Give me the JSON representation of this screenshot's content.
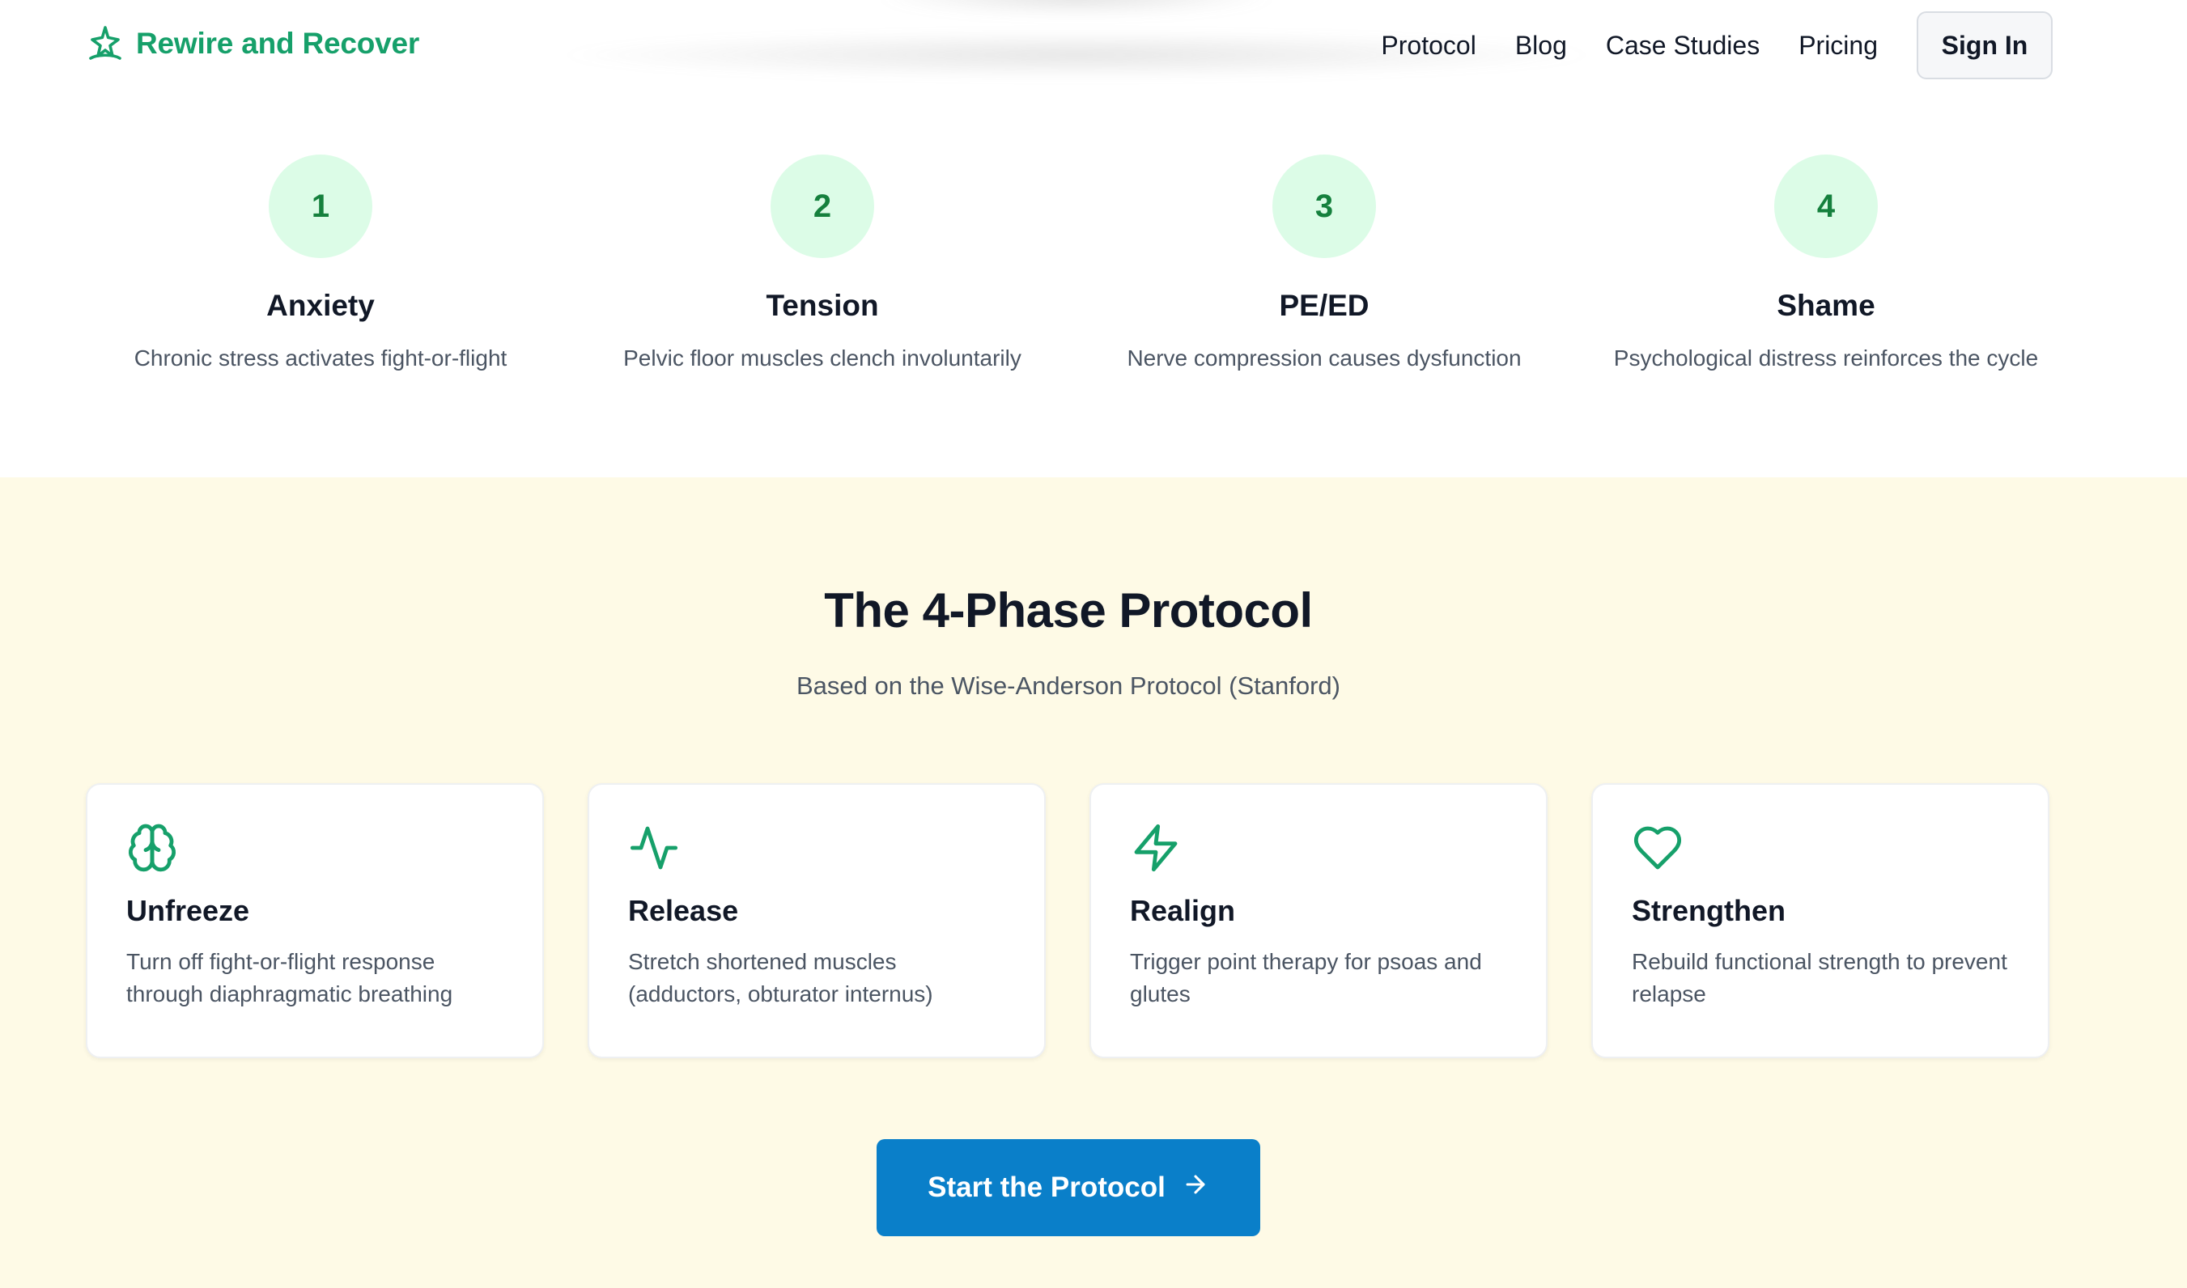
{
  "colors": {
    "brand": "#16a06a",
    "accent_blue": "#0a7fc9",
    "section_bg": "#fefae6",
    "step_circle": "#dcfce7"
  },
  "brand": {
    "name": "Rewire and Recover",
    "icon": "sprout-star-icon"
  },
  "nav": {
    "links": [
      "Protocol",
      "Blog",
      "Case Studies",
      "Pricing"
    ],
    "sign_in": "Sign In"
  },
  "cycle": {
    "steps": [
      {
        "number": "1",
        "title": "Anxiety",
        "desc": "Chronic stress activates fight-or-flight"
      },
      {
        "number": "2",
        "title": "Tension",
        "desc": "Pelvic floor muscles clench involuntarily"
      },
      {
        "number": "3",
        "title": "PE/ED",
        "desc": "Nerve compression causes dysfunction"
      },
      {
        "number": "4",
        "title": "Shame",
        "desc": "Psychological distress reinforces the cycle"
      }
    ]
  },
  "protocol": {
    "title": "The 4-Phase Protocol",
    "subtitle": "Based on the Wise-Anderson Protocol (Stanford)",
    "cards": [
      {
        "icon": "brain-icon",
        "title": "Unfreeze",
        "desc": "Turn off fight-or-flight response through diaphragmatic breathing"
      },
      {
        "icon": "activity-icon",
        "title": "Release",
        "desc": "Stretch shortened muscles (adductors, obturator internus)"
      },
      {
        "icon": "lightning-icon",
        "title": "Realign",
        "desc": "Trigger point therapy for psoas and glutes"
      },
      {
        "icon": "heart-icon",
        "title": "Strengthen",
        "desc": "Rebuild functional strength to prevent relapse"
      }
    ],
    "cta": "Start the Protocol",
    "cta_icon": "arrow-right-icon"
  }
}
